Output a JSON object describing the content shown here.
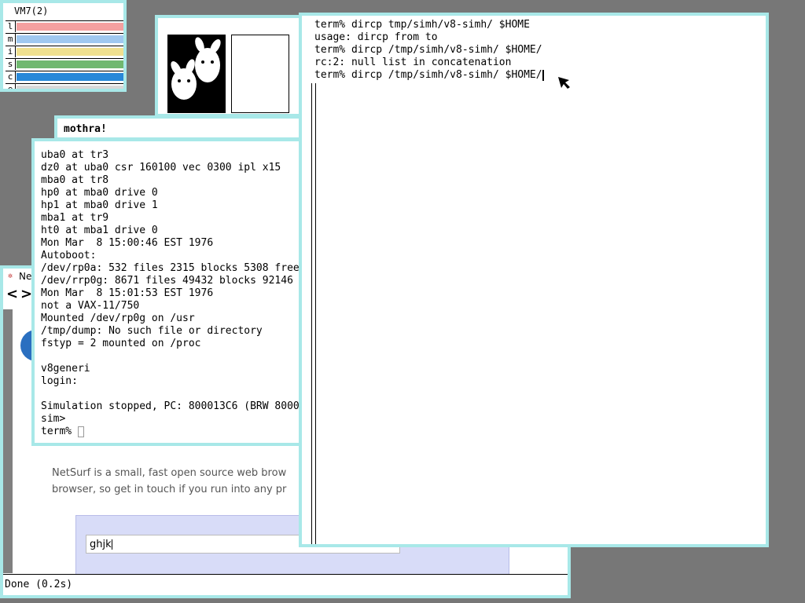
{
  "vmstat": {
    "title": "VM7(2)",
    "rows": [
      {
        "label": "l",
        "color": "#f4a0a0"
      },
      {
        "label": "m",
        "color": "#a0c8f0"
      },
      {
        "label": "i",
        "color": "#f0e090"
      },
      {
        "label": "s",
        "color": "#70b870"
      },
      {
        "label": "c",
        "color": "#2888d8"
      },
      {
        "label": "e",
        "color": "#d8d8d8"
      }
    ]
  },
  "mothra": {
    "title": "mothra!"
  },
  "netsurf": {
    "tab_title": "Ne",
    "back": "<",
    "forward": ">",
    "desc_line1": "NetSurf is a small, fast open source web brow",
    "desc_line2": "browser, so get in touch if you run into any pr",
    "input_value": "ghjk",
    "status": "Done (0.2s)"
  },
  "console": {
    "lines": [
      "uba0 at tr3",
      "dz0 at uba0 csr 160100 vec 0300 ipl x15",
      "mba0 at tr8",
      "hp0 at mba0 drive 0",
      "hp1 at mba0 drive 1",
      "mba1 at tr9",
      "ht0 at mba1 drive 0",
      "Mon Mar  8 15:00:46 EST 1976",
      "Autoboot:",
      "/dev/rp0a: 532 files 2315 blocks 5308 free",
      "/dev/rrp0g: 8671 files 49432 blocks 92146",
      "Mon Mar  8 15:01:53 EST 1976",
      "not a VAX-11/750",
      "Mounted /dev/rp0g on /usr",
      "/tmp/dump: No such file or directory",
      "fstyp = 2 mounted on /proc",
      "",
      "v8generi",
      "login:",
      "",
      "Simulation stopped, PC: 800013C6 (BRW 8000",
      "sim>"
    ],
    "prompt": "term% "
  },
  "term": {
    "lines": [
      "term% dircp tmp/simh/v8-simh/ $HOME",
      "usage: dircp from to",
      "term% dircp /tmp/simh/v8-simh/ $HOME/",
      "rc:2: null list in concatenation"
    ],
    "current": "term% dircp /tmp/simh/v8-simh/ $HOME/"
  }
}
